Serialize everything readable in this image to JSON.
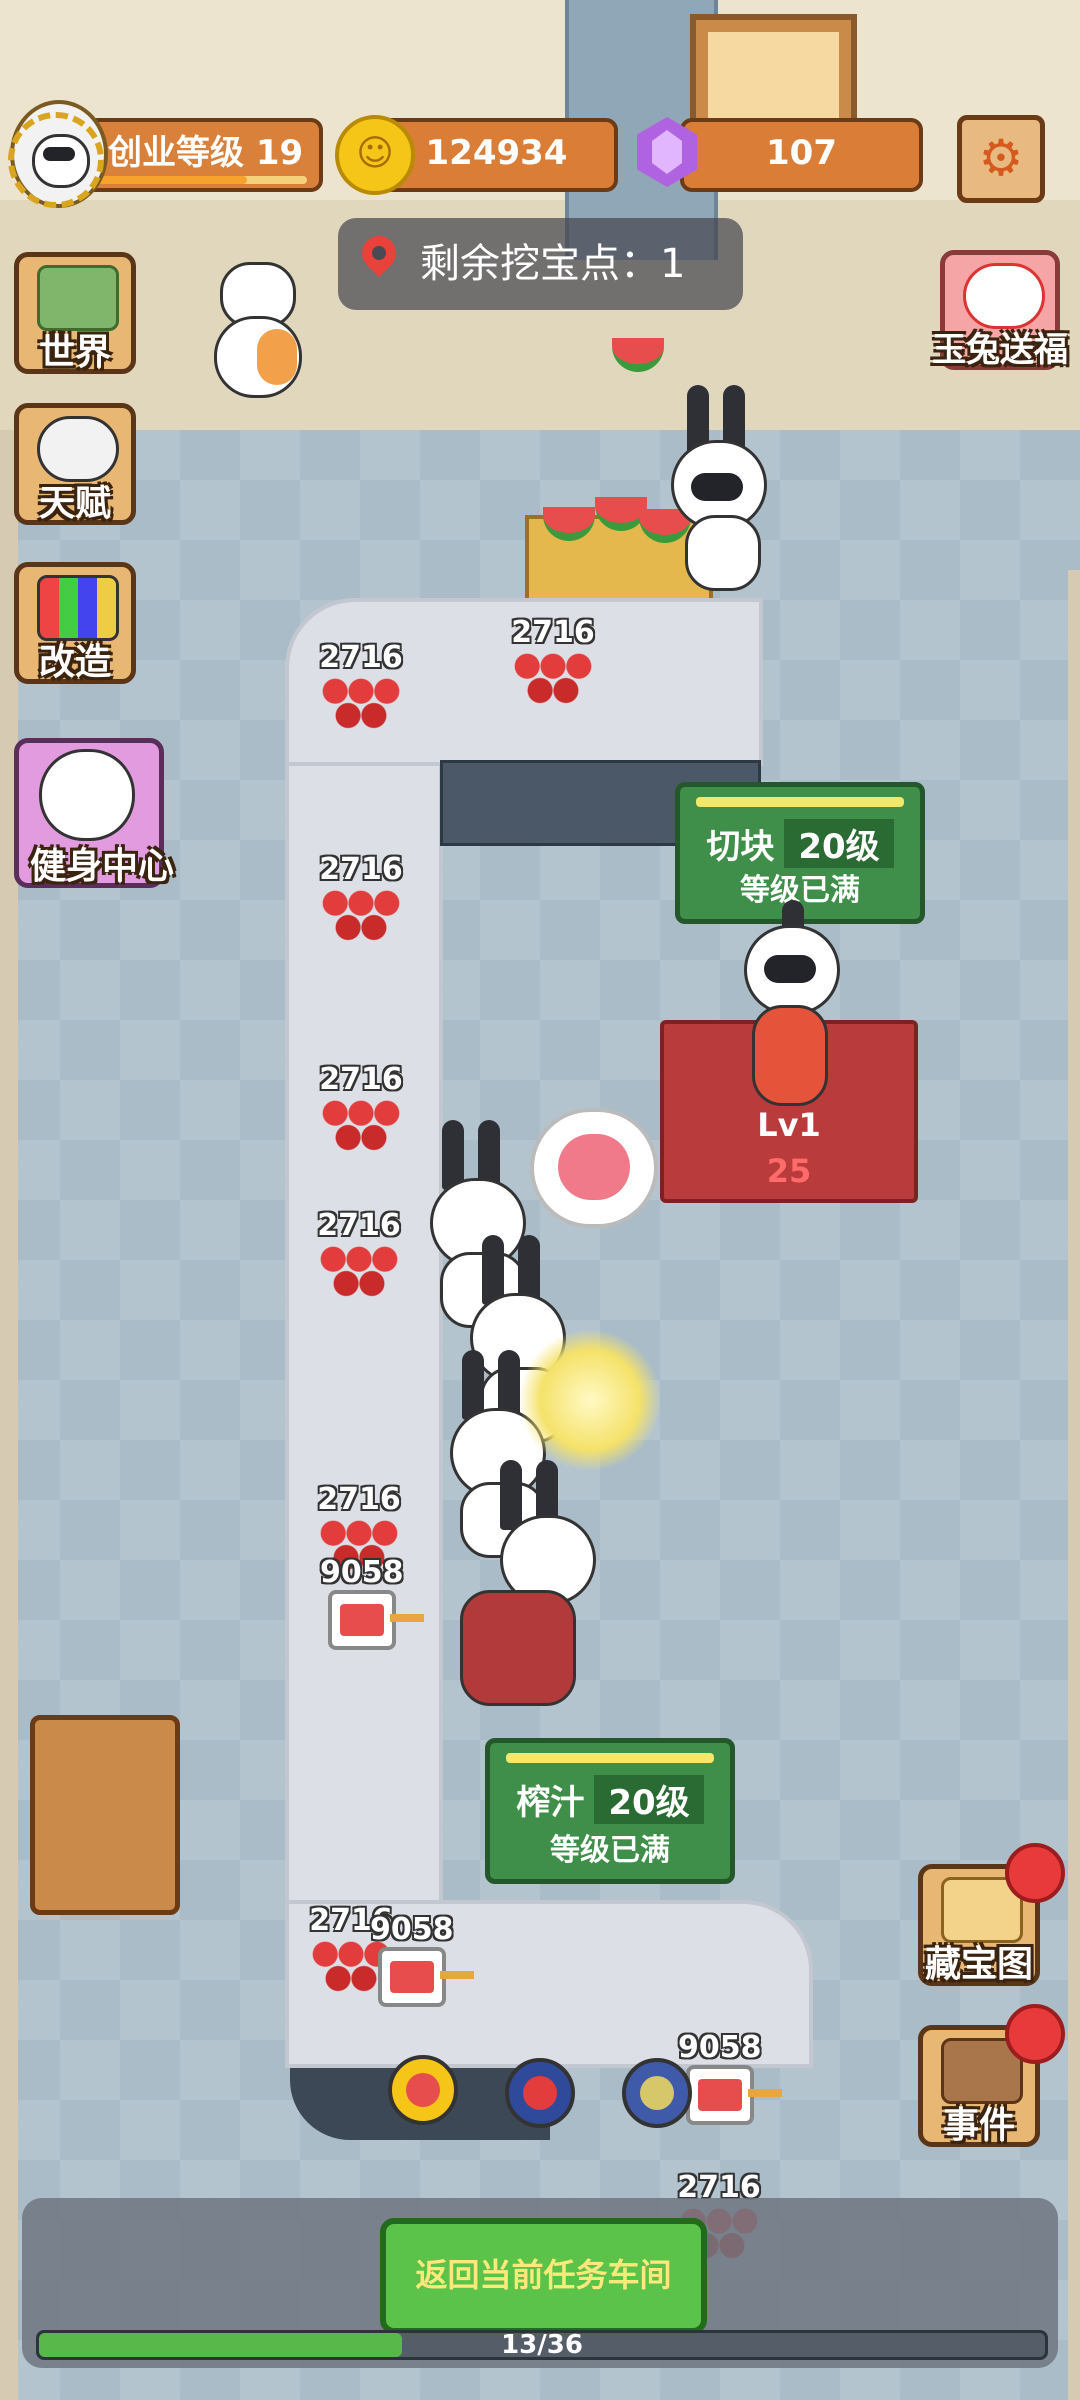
{
  "hud": {
    "level_label": "创业等级 19",
    "coins": "124934",
    "gems": "107",
    "dig_label": "剩余挖宝点：1"
  },
  "side_menu": {
    "world": "世界",
    "talent": "天赋",
    "reform": "改造",
    "gym": "健身中心",
    "rabbit": "玉兔送福",
    "treasure_map": "藏宝图",
    "events": "事件"
  },
  "stations": {
    "cut": {
      "name": "切块",
      "level": "20级",
      "status": "等级已满"
    },
    "juice": {
      "name": "榨汁",
      "level": "20级",
      "status": "等级已满"
    },
    "cutter_stand": {
      "level": "Lv1",
      "value": "25"
    }
  },
  "stacks": {
    "cube_count": "2716",
    "juice_count": "9058"
  },
  "bottom": {
    "return_label": "返回当前任务车间",
    "progress_text": "13/36",
    "progress_fraction": 0.361
  },
  "colors": {
    "station_green": "#3f8f4a",
    "hud_orange": "#d9803a",
    "return_green": "#5bc24a",
    "badge_red": "#e83a3a"
  },
  "icons": [
    "gear-icon",
    "coin-icon",
    "gem-icon",
    "location-pin-icon",
    "product-cube-icon",
    "product-juice-icon"
  ]
}
